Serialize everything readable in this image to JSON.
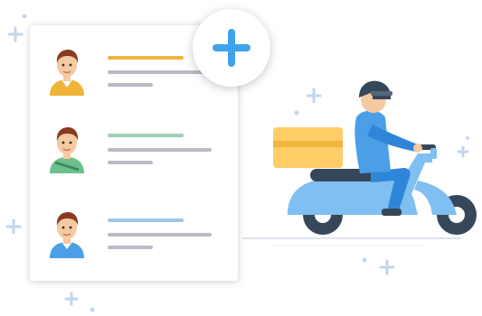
{
  "colors": {
    "accent_blue": "#3fa3ec",
    "bar_yellow": "#f0b43a",
    "bar_green": "#9fd0b4",
    "bar_blue": "#9cc8e8",
    "bar_gray": "#b9bcc6",
    "scooter_blue": "#7fbff1",
    "scooter_dark": "#36475a",
    "box_yellow": "#ffcc66",
    "sparkle": "#c3d6ec"
  },
  "list": {
    "items": [
      {
        "avatar_icon": "person-yellow-shirt-icon",
        "accent": "#f0b43a"
      },
      {
        "avatar_icon": "person-green-shirt-icon",
        "accent": "#9fd0b4"
      },
      {
        "avatar_icon": "person-blue-shirt-icon",
        "accent": "#9cc8e8"
      }
    ]
  },
  "add_button": {
    "icon": "plus-icon"
  },
  "illustration": {
    "icon": "delivery-scooter-icon"
  }
}
